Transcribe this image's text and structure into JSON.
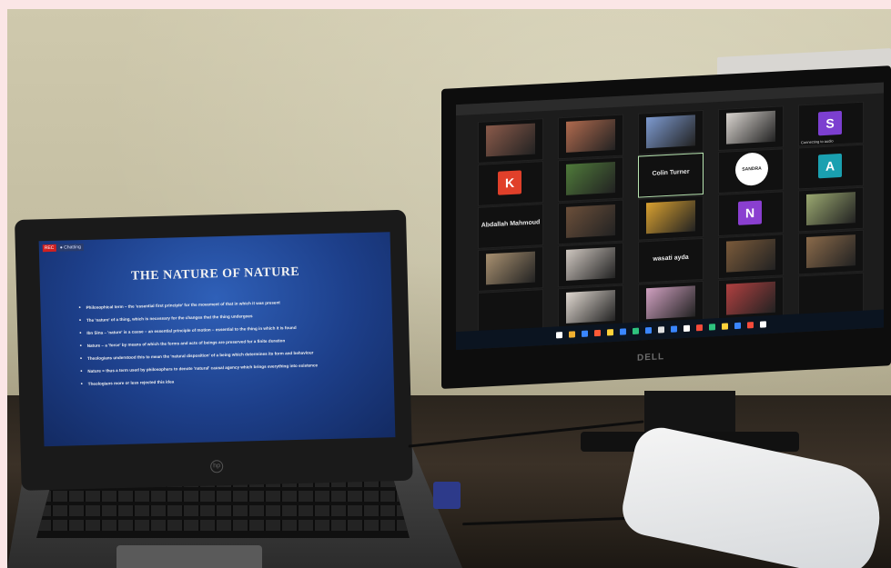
{
  "laptop": {
    "badge_rec": "REC",
    "badge_chat": "● Chatting",
    "logo": "hp",
    "slide_title": "THE NATURE OF NATURE",
    "bullets": [
      "Philosophical term – the 'essential first principle' for the movement of that in which it was present",
      "The 'nature' of a thing, which is necessary for the changes that the thing undergoes",
      "Ibn Sina – 'nature' is a cause – an essential principle of motion – essential to the thing in which it is found",
      "Nature – a 'force' by means of which the forms and acts of beings are preserved for a finite duration",
      "Theologians understood this to mean the 'natural disposition' of a being which determines its form and behaviour",
      "Nature = thus a term used by philosophers to denote 'natural' causal agency which brings everything into existence",
      "Theologians more or less rejected this idea"
    ]
  },
  "monitor": {
    "brand": "DELL",
    "tiles": [
      {
        "name": "",
        "kind": "photo",
        "color": "#8a5a4a"
      },
      {
        "name": "",
        "kind": "photo",
        "color": "#b06a4e"
      },
      {
        "name": "",
        "kind": "photo",
        "color": "#7d9ad0"
      },
      {
        "name": "",
        "kind": "photo",
        "color": "#d9d4cf"
      },
      {
        "name": "Connecting to audio",
        "kind": "letter",
        "letter": "S",
        "color": "#7c3fd0"
      },
      {
        "name": "",
        "kind": "letter",
        "letter": "K",
        "color": "#e0402a"
      },
      {
        "name": "",
        "kind": "photo",
        "color": "#4f7a3a"
      },
      {
        "name": "Colin Turner",
        "kind": "name"
      },
      {
        "name": "",
        "kind": "logo",
        "text": "SANDRA Frank",
        "color": "#ffffff"
      },
      {
        "name": "",
        "kind": "letter",
        "letter": "A",
        "color": "#1aa0b0"
      },
      {
        "name": "Abdallah Mahmoud",
        "kind": "name"
      },
      {
        "name": "",
        "kind": "photo",
        "color": "#6b4f3a"
      },
      {
        "name": "",
        "kind": "photo",
        "color": "#d8a030"
      },
      {
        "name": "",
        "kind": "letter",
        "letter": "N",
        "color": "#8a3fd0"
      },
      {
        "name": "",
        "kind": "photo",
        "color": "#9aa870"
      },
      {
        "name": "",
        "kind": "photo",
        "color": "#a89070"
      },
      {
        "name": "",
        "kind": "photo",
        "color": "#cfc7c0"
      },
      {
        "name": "wasati ayda",
        "kind": "name"
      },
      {
        "name": "",
        "kind": "photo",
        "color": "#7a5a3a"
      },
      {
        "name": "",
        "kind": "photo",
        "color": "#8a6a4a"
      },
      {
        "name": "",
        "kind": "empty"
      },
      {
        "name": "",
        "kind": "photo",
        "color": "#e0d8d0"
      },
      {
        "name": "",
        "kind": "photo",
        "color": "#d0a0c0"
      },
      {
        "name": "",
        "kind": "photo",
        "color": "#b04040"
      },
      {
        "name": "",
        "kind": "empty"
      }
    ],
    "taskbar_icon_colors": [
      "#ffffff",
      "#f0b030",
      "#3a86ff",
      "#ff5a36",
      "#ffd23a",
      "#3a86ff",
      "#2ec27e",
      "#3a86ff",
      "#e0e0e0",
      "#3a86ff",
      "#ffffff",
      "#f54b3a",
      "#2ec27e",
      "#ffd23a",
      "#3a86ff",
      "#f54b3a",
      "#ffffff"
    ]
  }
}
